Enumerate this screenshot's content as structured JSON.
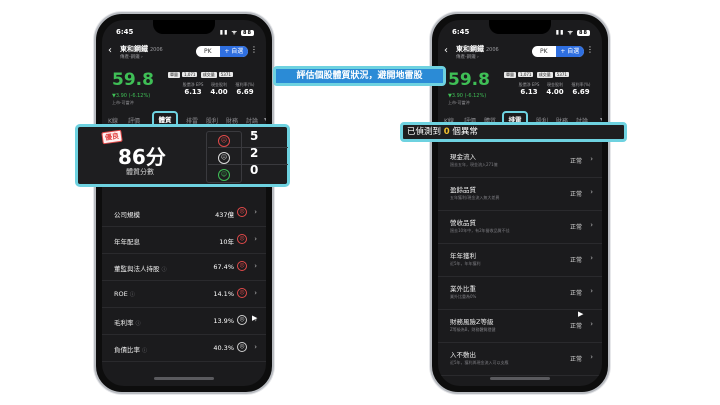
{
  "status": {
    "time": "6:45",
    "battery": "88"
  },
  "stock": {
    "name": "東和鋼鐵",
    "code": "2006",
    "category": "傳產-鋼鐵 ›",
    "price": "59.8",
    "change": "▼3.90 (-6.12%)",
    "note": "上市-可當沖"
  },
  "buttons": {
    "pk": "PK",
    "watch": "+ 自選"
  },
  "pills": [
    "單量",
    "成交量"
  ],
  "pills_values": [
    "1,071",
    "5371"
  ],
  "metrics": [
    {
      "label": "股價淨 EPS",
      "value": "6.13"
    },
    {
      "label": "現金股利",
      "value": "4.00"
    },
    {
      "label": "殖利率(%)",
      "value": "6.69"
    }
  ],
  "tabs_left": [
    "K線",
    "評價",
    "體質",
    "排雷",
    "股利",
    "財務",
    "討論"
  ],
  "tabs_right": [
    "K線",
    "評價",
    "體質",
    "排雷",
    "股利",
    "財務",
    "討論"
  ],
  "headline": "評估個股體質狀況，避開地雷股",
  "score": {
    "tag": "優良",
    "value": "86分",
    "label": "體質分數",
    "counts": [
      "5",
      "2",
      "0"
    ]
  },
  "faces": {
    "bad": "☹",
    "neutral": "😐",
    "good": "☺"
  },
  "quality_rows": [
    {
      "label": "公司規模",
      "value": "437億",
      "face": "bad"
    },
    {
      "label": "年年配息",
      "value": "10年",
      "face": "bad"
    },
    {
      "label": "董監與法人持股",
      "value": "67.4%",
      "face": "bad"
    },
    {
      "label": "ROE",
      "value": "14.1%",
      "face": "bad"
    },
    {
      "label": "毛利率",
      "value": "13.9%",
      "face": "neutral"
    },
    {
      "label": "負債比率",
      "value": "40.3%",
      "face": "neutral"
    }
  ],
  "detect": {
    "prefix": "已偵測到",
    "count": "0",
    "suffix": "個異常"
  },
  "risk_rows": [
    {
      "label": "現金流入",
      "sub": "過去五年，現金流入271億",
      "value": "正常"
    },
    {
      "label": "盈餘品質",
      "sub": "五年獲利/現金流入無大差異",
      "value": "正常"
    },
    {
      "label": "營收品質",
      "sub": "過去10年中，有2年營收品質不佳",
      "value": "正常"
    },
    {
      "label": "年年獲利",
      "sub": "近5年，年年獲利",
      "value": "正常"
    },
    {
      "label": "業外比重",
      "sub": "業外比重為0%",
      "value": "正常"
    },
    {
      "label": "財務風險Z等級",
      "sub": "Z等級為B，財務體質穩健",
      "value": "正常"
    },
    {
      "label": "入不敷出",
      "sub": "近5年，獲利與現金流入可以支應",
      "value": "正常"
    }
  ],
  "colors": {
    "accent": "#6ed2e0",
    "up": "#3fbf56",
    "down": "#e24a4a",
    "banner": "#2b8bd6",
    "warn": "#f2c12e"
  }
}
